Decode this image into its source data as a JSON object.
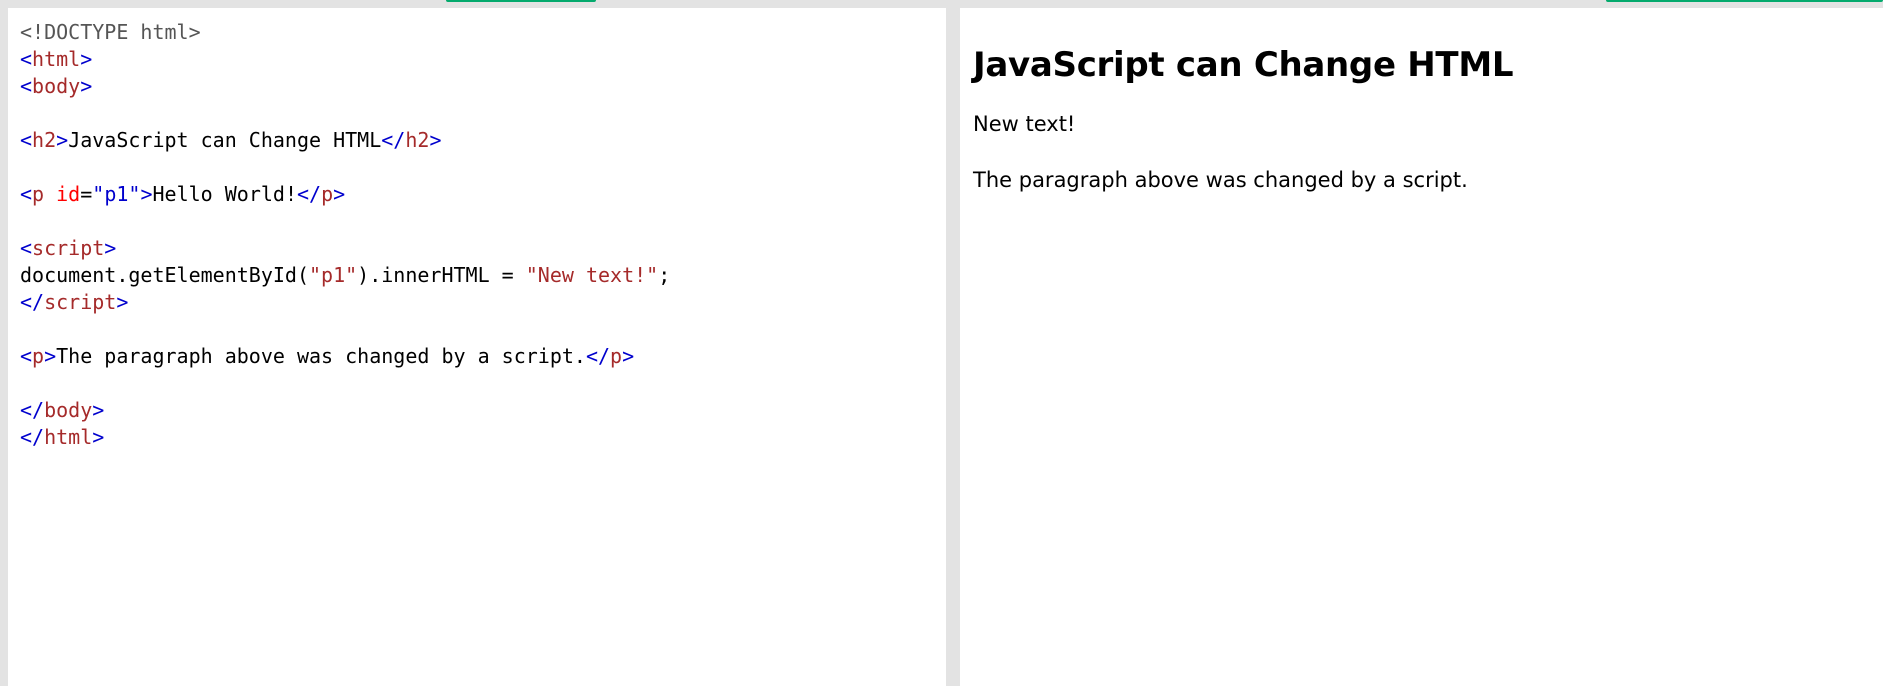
{
  "code": {
    "doctype": "<!DOCTYPE html>",
    "html_open": "html",
    "body_open": "body",
    "h2_tag": "h2",
    "h2_text": "JavaScript can Change HTML",
    "p_tag": "p",
    "p_attr": "id",
    "p_attr_value": "\"p1\"",
    "p_text": "Hello World!",
    "script_tag": "script",
    "script_call": "document.getElementById(",
    "script_arg": "\"p1\"",
    "script_prop": ").innerHTML = ",
    "script_string": "\"New text!\"",
    "script_end": ";",
    "p2_text": "The paragraph above was changed by a script.",
    "body_close": "body",
    "html_close": "html"
  },
  "result": {
    "heading": "JavaScript can Change HTML",
    "p1_text": "New text!",
    "p2_text": "The paragraph above was changed by a script."
  },
  "colors": {
    "tag": "#a52a2a",
    "bracket": "#0000cd",
    "attribute": "#ff0000",
    "tab_accent": "#04aa6d"
  }
}
